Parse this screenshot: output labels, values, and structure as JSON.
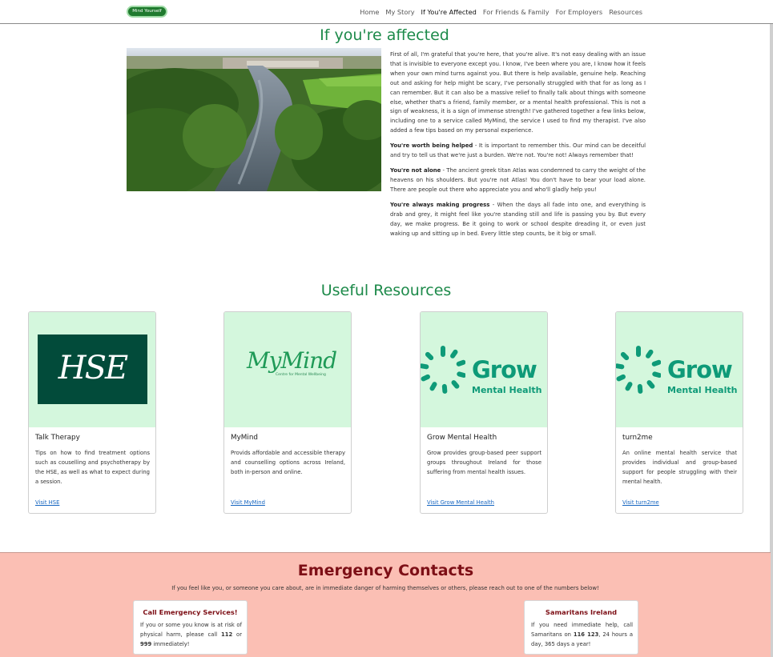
{
  "navbar": {
    "brand": "Mind Yourself",
    "links": [
      "Home",
      "My Story",
      "If You're Affected",
      "For Friends & Family",
      "For Employers",
      "Resources"
    ],
    "active_index": 2
  },
  "hero": {
    "title": "If you're affected",
    "intro": "First of all, I'm grateful that you're here, that you're alive. It's not easy dealing with an issue that is invisible to everyone except you. I know, I've been where you are, I know how it feels when your own mind turns against you. But there is help available, genuine help. Reaching out and asking for help might be scary, I've personally struggled with that for as long as I can remember. But it can also be a massive relief to finally talk about things with someone else, whether that's a friend, family member, or a mental health professional. This is not a sign of weakness, it is a sign of immense strength! I've gathered together a few links below, including one to a service called MyMind, the service I used to find my therapist. I've also added a few tips based on my personal experience.",
    "tips": [
      {
        "heading": "You're worth being helped",
        "text": " - It is important to remember this. Our mind can be deceitful and try to tell us that we're just a burden. We're not. You're not! Always remember that!"
      },
      {
        "heading": "You're not alone",
        "text": " - The ancient greek titan Atlas was condemned to carry the weight of the heavens on his shoulders. But you're not Atlas! You don't have to bear your load alone. There are people out there who appreciate you and who'll gladly help you!"
      },
      {
        "heading": "You're always making progress",
        "text": " - When the days all fade into one, and everything is drab and grey, it might feel like you're standing still and life is passing you by. But every day, we make progress. Be it going to work or school despite dreading it, or even just waking up and sitting up in bed. Every little step counts, be it big or small."
      }
    ]
  },
  "resources": {
    "title": "Useful Resources",
    "cards": [
      {
        "title": "Talk Therapy",
        "description": "Tips on how to find treatment options such as couselling and psychotherapy by the HSE, as well as what to expect during a session.",
        "link": "Visit HSE",
        "logo_text": "HSE",
        "logo": "hse-logo"
      },
      {
        "title": "MyMind",
        "description": "Provids affordable and accessible therapy and counselling options across Ireland, both in-person and online.",
        "link": "Visit MyMind",
        "logo_text": "MyMind",
        "logo_subtext": "Centre for Mental Wellbeing",
        "logo": "mymind-logo"
      },
      {
        "title": "Grow Mental Health",
        "description": "Grow provides group-based peer support groups throughout Ireland for those suffering from mental health issues.",
        "link": "Visit Grow Mental Health",
        "logo_text": "Grow",
        "logo_subtext": "Mental Health",
        "logo": "grow-logo"
      },
      {
        "title": "turn2me",
        "description": "An online mental health service that provides individual and group-based support for people struggling with their mental health.",
        "link": "Visit turn2me",
        "logo_text": "Grow",
        "logo_subtext": "Mental Health",
        "logo": "grow-logo"
      }
    ]
  },
  "emergency": {
    "title": "Emergency Contacts",
    "subtitle": "If you feel like you, or someone you care about, are in immediate danger of harming themselves or others, please reach out to one of the numbers below!",
    "cards": [
      {
        "title": "Call Emergency Services!",
        "text_a": "If you or some you know is at risk of physical harm, please call ",
        "num_a": "112",
        "text_b": " or ",
        "num_b": "999",
        "text_c": " immediately!"
      },
      {
        "title": "Samaritans Ireland",
        "text_a": "If you need immediate help, call Samaritans on ",
        "num_a": "116 123",
        "text_b": ", 24 hours a day, 365 days a year!",
        "num_b": "",
        "text_c": ""
      }
    ]
  },
  "colors": {
    "heading_green": "#1d8a4a",
    "card_thumb_bg": "#d4f7dd",
    "hse_green": "#024b3a",
    "grow_green": "#0e9a78",
    "emergency_bg": "#fbbfb4",
    "emergency_title": "#7d0f16",
    "link_blue": "#1565c0"
  }
}
